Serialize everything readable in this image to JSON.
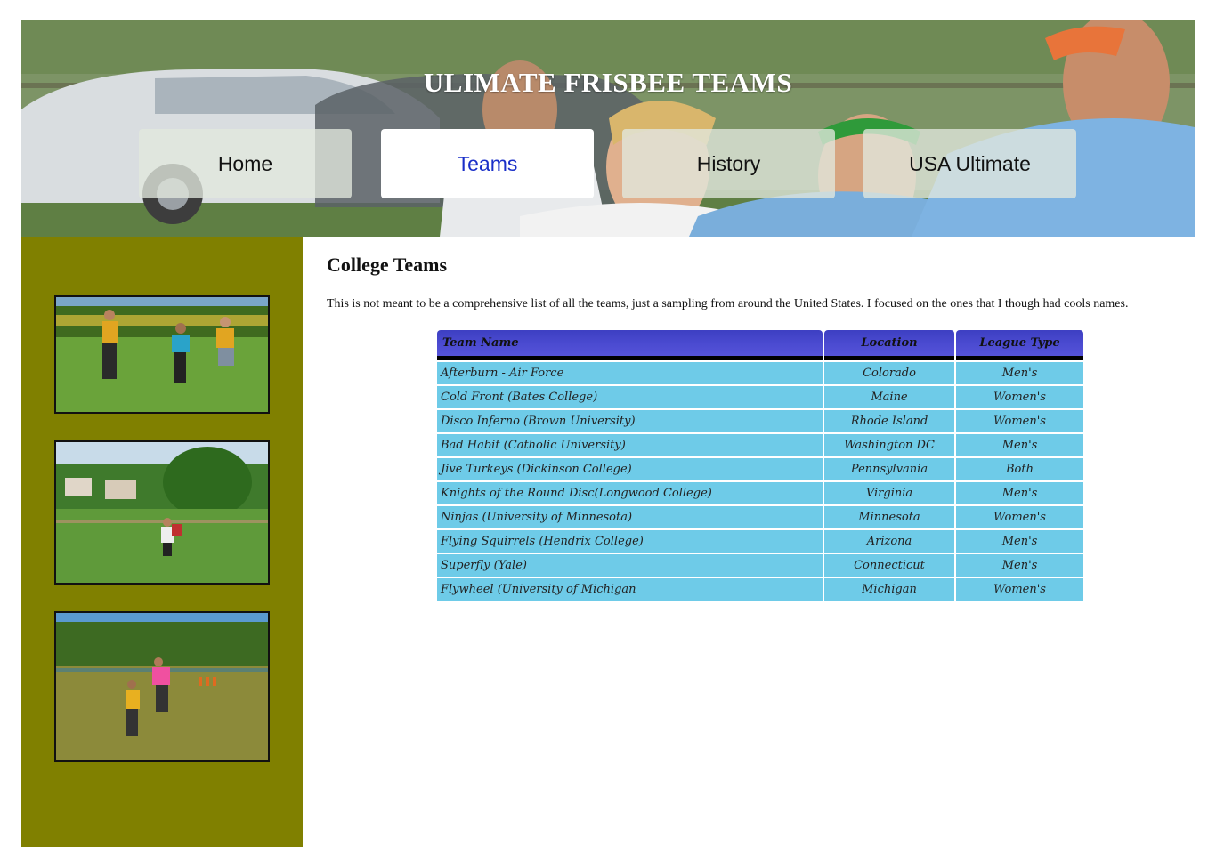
{
  "header": {
    "title": "ULIMATE FRISBEE TEAMS",
    "nav": [
      {
        "label": "Home",
        "active": false
      },
      {
        "label": "Teams",
        "active": true
      },
      {
        "label": "History",
        "active": false
      },
      {
        "label": "USA Ultimate",
        "active": false
      }
    ]
  },
  "colors": {
    "sidebar": "#808000",
    "nav_active_text": "#1a2fc8",
    "table_header": "#4a4ad0",
    "table_cell": "#6ecbe8"
  },
  "main": {
    "heading": "College Teams",
    "intro": "This is not meant to be a comprehensive list of all the teams, just a sampling from around the United States. I focused on the ones that I though had cools names.",
    "table": {
      "headers": {
        "name": "Team Name",
        "location": "Location",
        "league": "League Type"
      },
      "rows": [
        {
          "name": "Afterburn - Air Force",
          "location": "Colorado",
          "league": "Men's"
        },
        {
          "name": "Cold Front (Bates College)",
          "location": "Maine",
          "league": "Women's"
        },
        {
          "name": "Disco Inferno (Brown University)",
          "location": "Rhode Island",
          "league": "Women's"
        },
        {
          "name": "Bad Habit (Catholic University)",
          "location": "Washington DC",
          "league": "Men's"
        },
        {
          "name": "Jive Turkeys (Dickinson College)",
          "location": "Pennsylvania",
          "league": "Both"
        },
        {
          "name": "Knights of the Round Disc(Longwood College)",
          "location": "Virginia",
          "league": "Men's"
        },
        {
          "name": "Ninjas (University of Minnesota)",
          "location": "Minnesota",
          "league": "Women's"
        },
        {
          "name": "Flying Squirrels (Hendrix College)",
          "location": "Arizona",
          "league": "Men's"
        },
        {
          "name": "Superfly (Yale)",
          "location": "Connecticut",
          "league": "Men's"
        },
        {
          "name": "Flywheel (University of Michigan",
          "location": "Michigan",
          "league": "Women's"
        }
      ]
    }
  }
}
